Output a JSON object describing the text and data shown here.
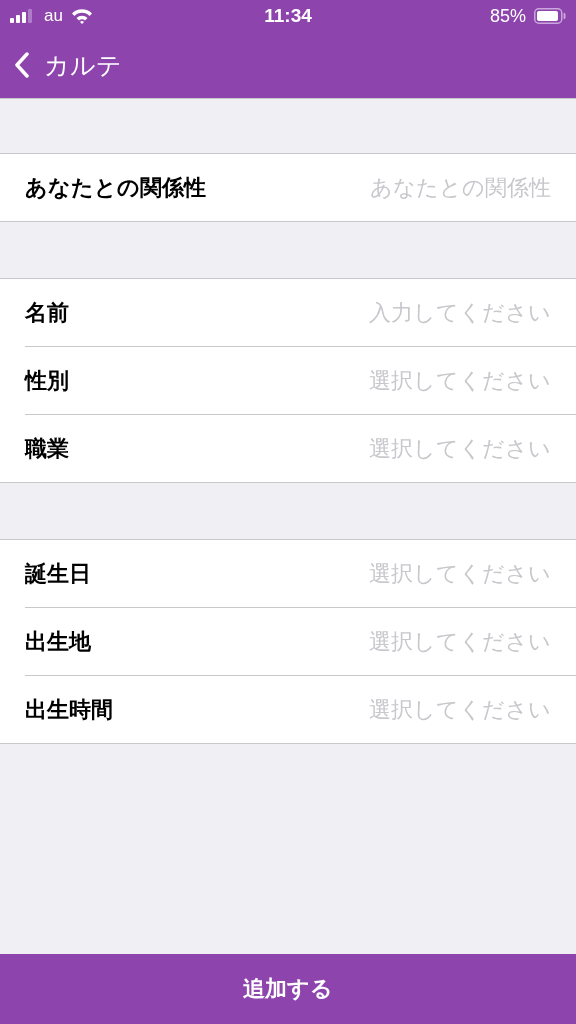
{
  "status_bar": {
    "carrier": "au",
    "time": "11:34",
    "battery": "85%"
  },
  "nav": {
    "back_title": "カルテ"
  },
  "groups": [
    {
      "rows": [
        {
          "label": "あなたとの関係性",
          "placeholder": "あなたとの関係性"
        }
      ]
    },
    {
      "rows": [
        {
          "label": "名前",
          "placeholder": "入力してください"
        },
        {
          "label": "性別",
          "placeholder": "選択してください"
        },
        {
          "label": "職業",
          "placeholder": "選択してください"
        }
      ]
    },
    {
      "rows": [
        {
          "label": "誕生日",
          "placeholder": "選択してください"
        },
        {
          "label": "出生地",
          "placeholder": "選択してください"
        },
        {
          "label": "出生時間",
          "placeholder": "選択してください"
        }
      ]
    }
  ],
  "submit_button": "追加する"
}
